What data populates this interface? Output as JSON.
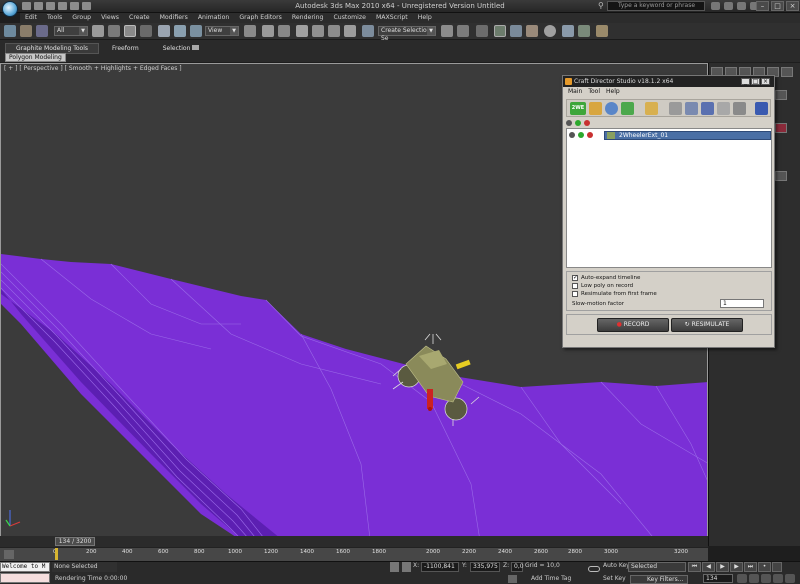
{
  "app": {
    "title": "Autodesk 3ds Max  2010 x64  -  Unregistered Version   Untitled",
    "search_placeholder": "Type a keyword or phrase"
  },
  "menu": [
    "Edit",
    "Tools",
    "Group",
    "Views",
    "Create",
    "Modifiers",
    "Animation",
    "Graph Editors",
    "Rendering",
    "Customize",
    "MAXScript",
    "Help"
  ],
  "toolbar": {
    "selection_filter": "All",
    "reference_coord": "View",
    "selection_set": "Create Selection Se"
  },
  "ribbon": {
    "tabs": [
      "Graphite Modeling Tools",
      "Freeform",
      "Selection"
    ],
    "subtab": "Polygon Modeling"
  },
  "viewport": {
    "label": "[ + ] [ Perspective ] [ Smooth + Highlights + Edged Faces ]",
    "terrain_color": "#7a2fd6"
  },
  "craft_director": {
    "title": "Craft Director Studio v18.1.2 x64",
    "menu": [
      "Main",
      "Tool",
      "Help"
    ],
    "toolbar_badge": "2WE",
    "row_label": "2WheelerExt_01",
    "options": {
      "auto_expand": "Auto-expand timeline",
      "low_poly": "Low poly on record",
      "resimulate": "Resimulate from first frame",
      "slow_motion_label": "Slow-motion factor",
      "slow_motion_value": "1"
    },
    "record_label": "RECORD",
    "resimulate_label": "RESIMULATE"
  },
  "timeline": {
    "slider_label": "134 / 3200",
    "ticks": [
      "0",
      "200",
      "400",
      "600",
      "800",
      "1000",
      "1200",
      "1400",
      "1600",
      "1800",
      "2000",
      "2200",
      "2400",
      "2600",
      "2800",
      "3000",
      "3200"
    ]
  },
  "status": {
    "maxscript": "Welcome to M",
    "selection": "None Selected",
    "render_time": "Rendering Time  0:00:00",
    "x_label": "X:",
    "x_value": "-1100,841",
    "y_label": "Y:",
    "y_value": "335,975",
    "z_label": "Z:",
    "z_value": "0,0",
    "grid": "Grid = 10,0",
    "add_time_tag": "Add Time Tag",
    "auto_key": "Auto Key",
    "set_key": "Set Key",
    "selected_dd": "Selected",
    "key_filters": "Key Filters...",
    "frame": "134"
  }
}
